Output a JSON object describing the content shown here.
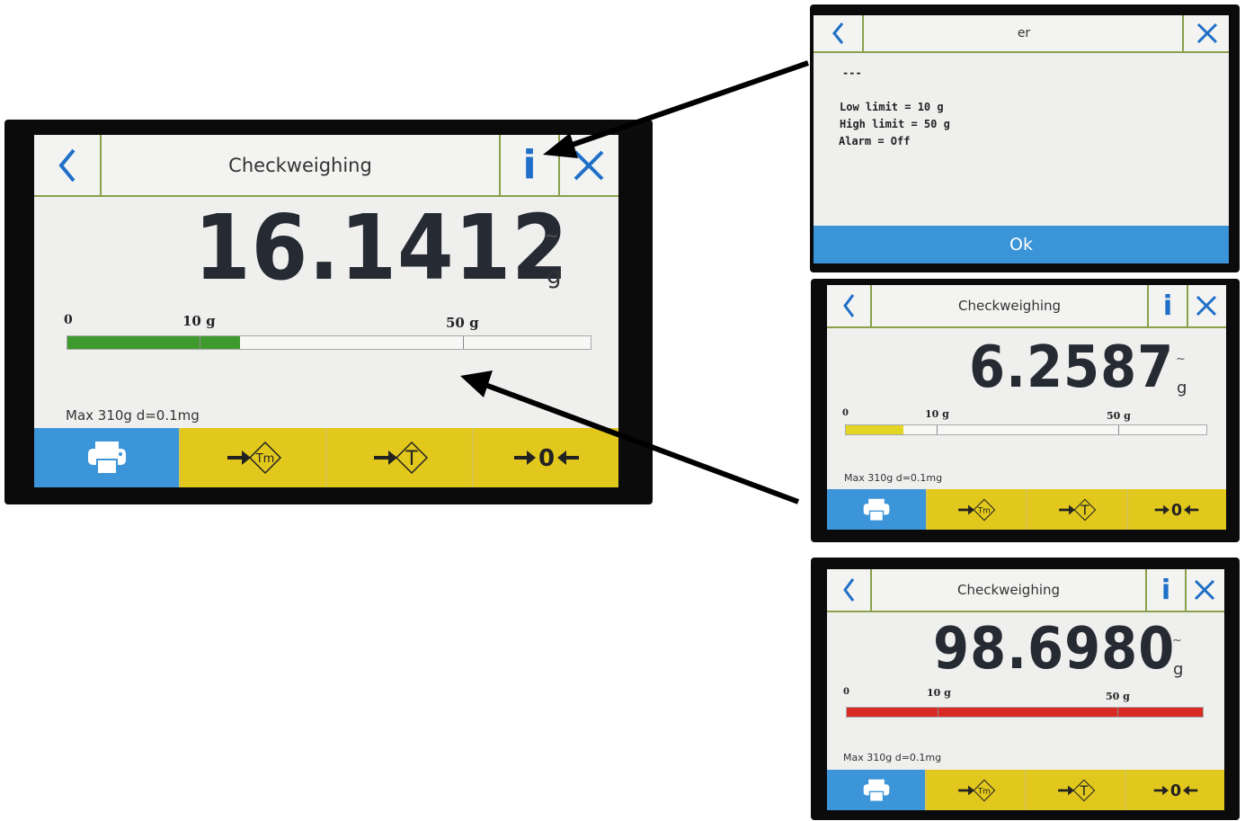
{
  "main_screen": {
    "title": "Checkweighing",
    "reading": "16.1412",
    "unit": "g",
    "stability_mark": "~",
    "scale": {
      "zero": "0",
      "low": "10 g",
      "high": "50 g",
      "fill_fraction": 0.33,
      "fill_color": "#3f9a2e"
    },
    "specs": "Max 310g   d=0.1mg",
    "buttons": [
      "print-icon",
      "tare-memory-icon",
      "tare-icon",
      "zero-icon"
    ]
  },
  "info_popup": {
    "title": "er",
    "separator": "---",
    "lines": [
      "Low limit = 10 g",
      "High limit = 50 g",
      "Alarm = Off"
    ],
    "ok_label": "Ok"
  },
  "under_screen": {
    "title": "Checkweighing",
    "reading": "6.2587",
    "unit": "g",
    "stability_mark": "~",
    "scale": {
      "zero": "0",
      "low": "10 g",
      "high": "50 g",
      "fill_fraction": 0.16,
      "fill_color": "#e3d524"
    },
    "specs": "Max 310g   d=0.1mg"
  },
  "over_screen": {
    "title": "Checkweighing",
    "reading": "98.6980",
    "unit": "g",
    "stability_mark": "~",
    "scale": {
      "zero": "0",
      "low": "10 g",
      "high": "50 g",
      "fill_fraction": 1.0,
      "fill_color": "#d82a22"
    },
    "specs": "Max 310g   d=0.1mg"
  },
  "colors": {
    "header_line": "#8aa04a",
    "accent_blue": "#1f6fc8",
    "print_button": "#3d95d9",
    "function_button": "#e2c81d"
  }
}
